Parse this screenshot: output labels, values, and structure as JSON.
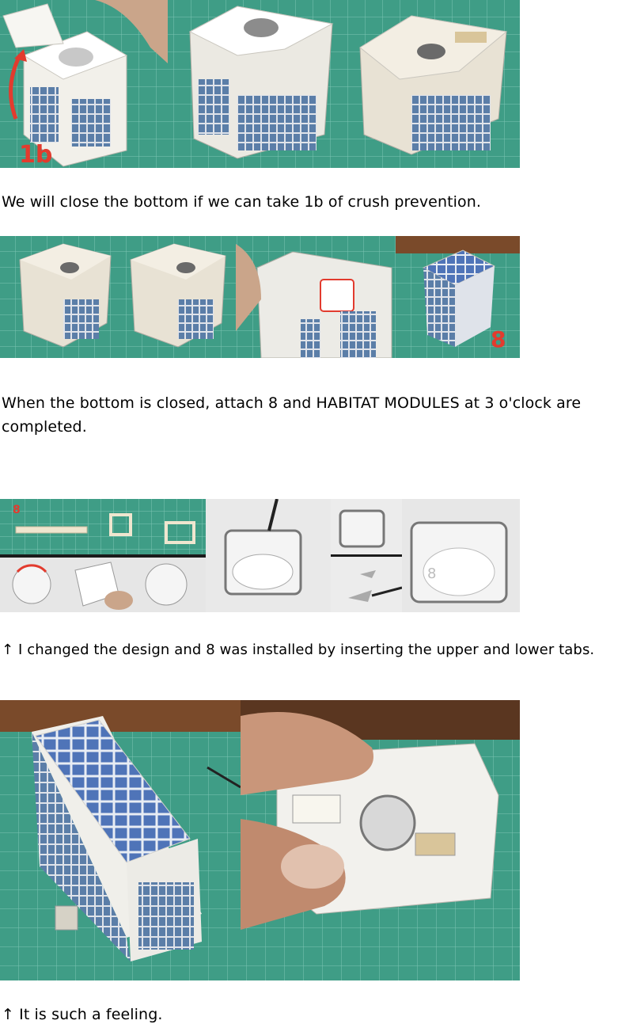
{
  "sections": [
    {
      "photos": [
        {
          "label": "1b",
          "alt": "box-1b-closing"
        },
        {
          "alt": "box-top-view"
        },
        {
          "alt": "box-top-view-lit"
        }
      ],
      "caption": "We will close the bottom if we can take 1b of crush prevention."
    },
    {
      "photos": [
        {
          "alt": "module-side-a"
        },
        {
          "alt": "module-side-b"
        },
        {
          "alt": "module-open-bottom"
        },
        {
          "label": "8",
          "alt": "module-with-solar-panel"
        }
      ],
      "caption": "When the bottom is closed, attach 8 and HABITAT MODULES at 3 o'clock are completed."
    },
    {
      "photos": [
        {
          "label": "8",
          "alt": "part-8-assembly-collage"
        },
        {
          "alt": "ring-frame"
        },
        {
          "alt": "tabs-insertion"
        },
        {
          "label": "8",
          "alt": "ring-installed"
        }
      ],
      "caption": "↑ I changed the design and 8 was installed by inserting the upper and lower tabs."
    },
    {
      "photos": [
        {
          "alt": "finished-module-solar-top"
        },
        {
          "alt": "finished-module-in-hand"
        }
      ],
      "caption": "↑ It is such a feeling."
    }
  ],
  "colors": {
    "mat_green": "#3f9d86",
    "mat_grid": "#7cc5b4",
    "paper": "#f2f0ea",
    "window_blue": "#5b7ea8",
    "label_red": "#e23b2e",
    "wood": "#7a4a2a"
  }
}
